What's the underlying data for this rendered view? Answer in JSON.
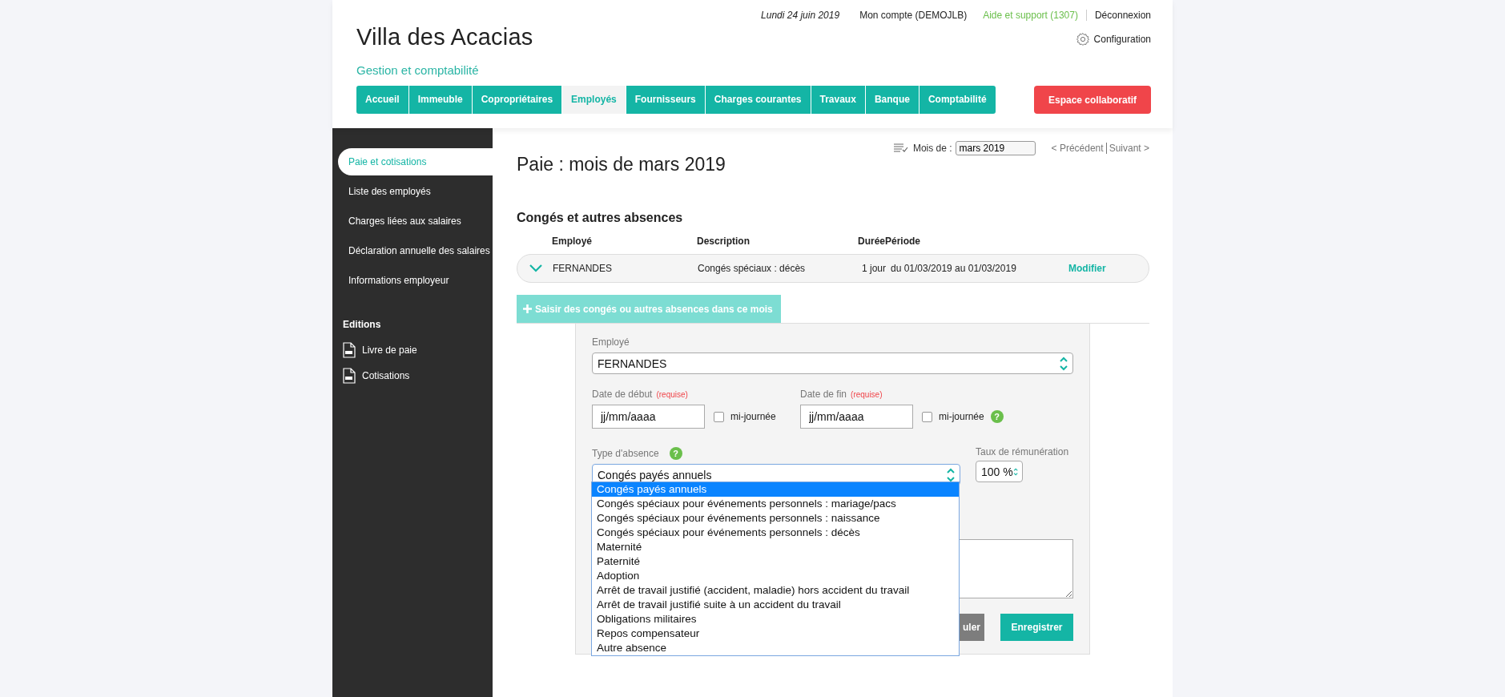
{
  "header": {
    "date": "Lundi 24 juin 2019",
    "links": [
      {
        "label": "Mon compte (DEMOJLB)",
        "kind": "normal"
      },
      {
        "label": "Aide et support (1307)",
        "kind": "highlight"
      },
      {
        "label": "Déconnexion",
        "kind": "normal"
      }
    ],
    "settings": "Configuration",
    "site_title": "Villa des Acacias",
    "subtitle": "Gestion et comptabilité"
  },
  "nav": {
    "tabs": [
      {
        "label": "Accueil",
        "selected": false
      },
      {
        "label": "Immeuble",
        "selected": false
      },
      {
        "label": "Copropriétaires",
        "selected": false
      },
      {
        "label": "Employés",
        "selected": true
      },
      {
        "label": "Fournisseurs",
        "selected": false
      },
      {
        "label": "Charges courantes",
        "selected": false
      },
      {
        "label": "Travaux",
        "selected": false
      },
      {
        "label": "Banque",
        "selected": false
      },
      {
        "label": "Comptabilité",
        "selected": false
      }
    ],
    "collab_button": "Espace collaboratif"
  },
  "sidebar": {
    "items": [
      {
        "label": "Paie et cotisations",
        "selected": true
      },
      {
        "label": "Liste des employés",
        "selected": false
      },
      {
        "label": "Charges liées aux salaires",
        "selected": false
      },
      {
        "label": "Déclaration annuelle des salaires",
        "selected": false
      },
      {
        "label": "Informations employeur",
        "selected": false
      }
    ],
    "section": "Editions",
    "documents": [
      {
        "label": "Livre de paie"
      },
      {
        "label": "Cotisations"
      }
    ]
  },
  "page": {
    "title": "Paie : mois de mars 2019",
    "month_label": "Mois de :",
    "month_value": "mars 2019",
    "prev": "< Précédent",
    "next": "Suivant >"
  },
  "absences": {
    "title": "Congés et autres absences",
    "columns": [
      "Employé",
      "Description",
      "Durée",
      "Période"
    ],
    "rows": [
      {
        "employee": "FERNANDES",
        "description": "Congés spéciaux : décès",
        "duration": "1 jour",
        "period": "du 01/03/2019 au 01/03/2019",
        "action": "Modifier",
        "expanded": false
      }
    ],
    "add_button": "Saisir des congés ou autres absences dans ce mois"
  },
  "form": {
    "employee": {
      "label": "Employé",
      "value": "FERNANDES"
    },
    "start_date": {
      "label": "Date de début",
      "required": "(requise)",
      "placeholder": "jj/mm/aaaa",
      "half_day": "mi-journée",
      "checked": false
    },
    "end_date": {
      "label": "Date de fin",
      "required": "(requise)",
      "placeholder": "jj/mm/aaaa",
      "half_day": "mi-journée",
      "checked": false,
      "help": "?"
    },
    "absence_type": {
      "label": "Type d'absence",
      "help": "?",
      "value": "Congés payés annuels",
      "open": true,
      "options": [
        {
          "label": "Congés payés annuels",
          "selected": true
        },
        {
          "label": "Congés spéciaux pour événements personnels : mariage/pacs",
          "selected": false
        },
        {
          "label": "Congés spéciaux pour événements personnels : naissance",
          "selected": false
        },
        {
          "label": "Congés spéciaux pour événements personnels : décès",
          "selected": false
        },
        {
          "label": "Maternité",
          "selected": false
        },
        {
          "label": "Paternité",
          "selected": false
        },
        {
          "label": "Adoption",
          "selected": false
        },
        {
          "label": "Arrêt de travail justifié (accident, maladie) hors accident du travail",
          "selected": false
        },
        {
          "label": "Arrêt de travail justifié suite à un accident du travail",
          "selected": false
        },
        {
          "label": "Obligations militaires",
          "selected": false
        },
        {
          "label": "Repos compensateur",
          "selected": false
        },
        {
          "label": "Autre absence",
          "selected": false
        }
      ]
    },
    "rate": {
      "label": "Taux de rémunération",
      "value": "100 %"
    },
    "cancel_button": "uler",
    "save_button": "Enregistrer"
  }
}
